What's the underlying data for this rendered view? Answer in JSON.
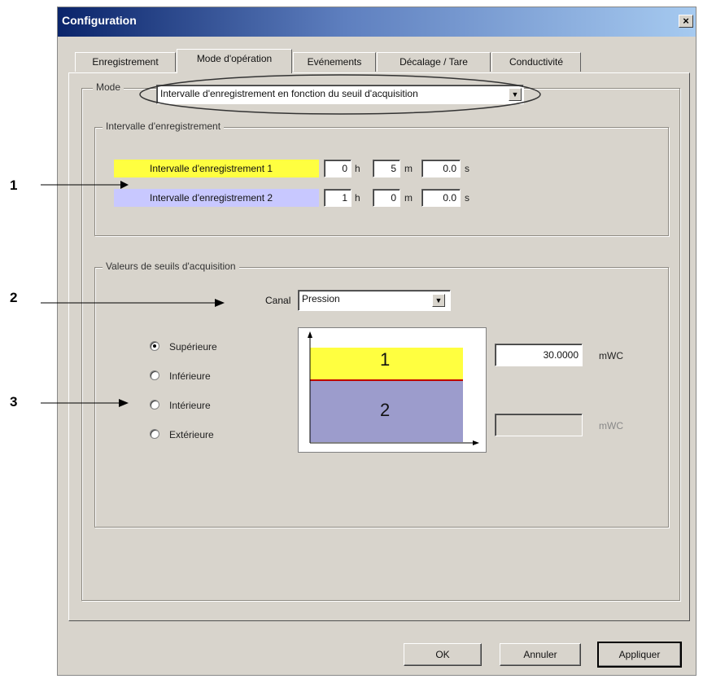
{
  "window": {
    "title": "Configuration",
    "close_glyph": "×"
  },
  "tabs": [
    {
      "label": "Enregistrement"
    },
    {
      "label": "Mode d'opération"
    },
    {
      "label": "Evénements"
    },
    {
      "label": "Décalage / Tare"
    },
    {
      "label": "Conductivité"
    }
  ],
  "active_tab": "Mode d'opération",
  "mode": {
    "label": "Mode",
    "value": "Intervalle d'enregistrement en fonction du seuil d'acquisition"
  },
  "interval_group": {
    "title": "Intervalle d'enregistrement",
    "rows": [
      {
        "label": "Intervalle d'enregistrement 1",
        "color": "#ffff40",
        "h": "0",
        "m": "5",
        "s": "0.0"
      },
      {
        "label": "Intervalle d'enregistrement 2",
        "color": "#c8c8ff",
        "h": "1",
        "m": "0",
        "s": "0.0"
      }
    ],
    "units": {
      "h": "h",
      "m": "m",
      "s": "s"
    }
  },
  "threshold_group": {
    "title": "Valeurs de seuils d'acquisition",
    "canal_label": "Canal",
    "canal_value": "Pression",
    "options": [
      {
        "label": "Supérieure",
        "selected": true
      },
      {
        "label": "Inférieure",
        "selected": false
      },
      {
        "label": "Intérieure",
        "selected": false
      },
      {
        "label": "Extérieure",
        "selected": false
      }
    ],
    "zone_labels": [
      "1",
      "2"
    ],
    "zone_colors": {
      "upper": "#ffff40",
      "lower": "#9c9ccc",
      "threshold_line": "#c00000"
    },
    "value_upper": "30.0000",
    "unit_upper": "mWC",
    "value_lower": "",
    "unit_lower": "mWC"
  },
  "buttons": {
    "ok": "OK",
    "cancel": "Annuler",
    "apply": "Appliquer"
  },
  "callouts": [
    "1",
    "2",
    "3"
  ]
}
